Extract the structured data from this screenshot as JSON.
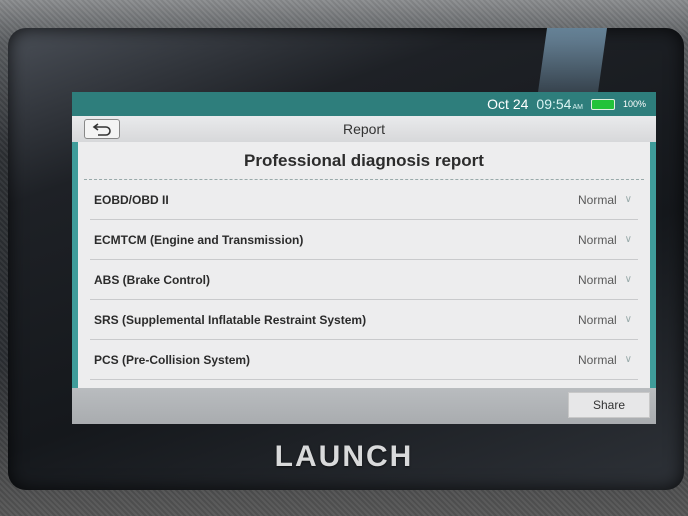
{
  "status_bar": {
    "date": "Oct 24",
    "time": "09:54",
    "ampm": "AM",
    "battery": "100%"
  },
  "header": {
    "back_icon": "back-arrow-icon",
    "title": "Report"
  },
  "report": {
    "heading": "Professional diagnosis report",
    "items": [
      {
        "label": "EOBD/OBD II",
        "status": "Normal"
      },
      {
        "label": "ECMTCM (Engine and Transmission)",
        "status": "Normal"
      },
      {
        "label": "ABS (Brake Control)",
        "status": "Normal"
      },
      {
        "label": "SRS (Supplemental Inflatable Restraint System)",
        "status": "Normal"
      },
      {
        "label": "PCS (Pre-Collision System)",
        "status": "Normal"
      }
    ]
  },
  "footer": {
    "share_label": "Share"
  },
  "device": {
    "brand": "LAUNCH"
  },
  "colors": {
    "accent": "#3f9c9a",
    "battery": "#22c33a"
  }
}
